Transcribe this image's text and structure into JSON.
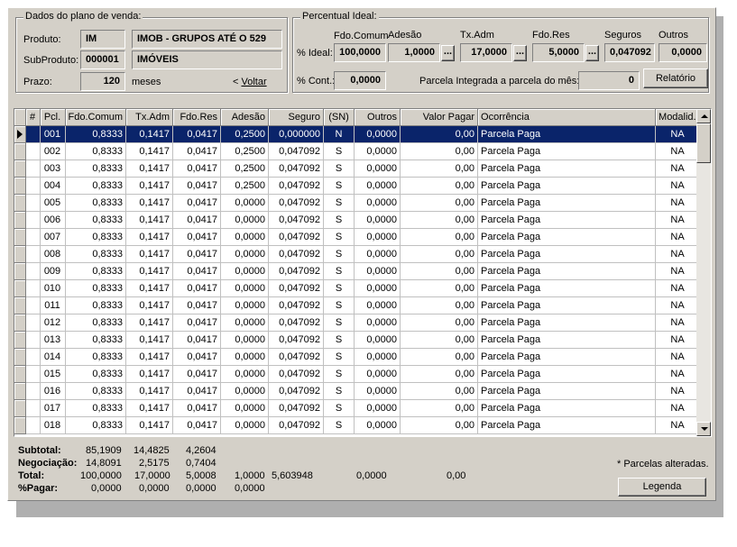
{
  "plano": {
    "group_title": "Dados do plano de venda:",
    "produto_label": "Produto:",
    "produto_code": "IM",
    "produto_desc": "IMOB - GRUPOS ATÉ O 529",
    "subproduto_label": "SubProduto:",
    "subproduto_code": "000001",
    "subproduto_desc": "IMÓVEIS",
    "prazo_label": "Prazo:",
    "prazo_value": "120",
    "prazo_unit": "meses",
    "voltar_prefix": "< ",
    "voltar_label": "Voltar"
  },
  "percentual": {
    "group_title": "Percentual Ideal:",
    "col_fdo_comum": "Fdo.Comum",
    "col_adesao": "Adesão",
    "col_tx_adm": "Tx.Adm",
    "col_fdo_res": "Fdo.Res",
    "col_seguros": "Seguros",
    "col_outros": "Outros",
    "ideal_label": "% Ideal:",
    "ideal_fdo_comum": "100,0000",
    "ideal_adesao": "1,0000",
    "ideal_tx_adm": "17,0000",
    "ideal_fdo_res": "5,0000",
    "ideal_seguros": "0,047092",
    "ideal_outros": "0,0000",
    "dots": "...",
    "cont_label": "% Cont.:",
    "cont_value": "0,0000",
    "parcela_label": "Parcela Integrada a parcela do mês:",
    "parcela_value": "0",
    "relatorio_label": "Relatório"
  },
  "grid": {
    "columns": [
      "#",
      "Pcl.",
      "Fdo.Comum",
      "Tx.Adm",
      "Fdo.Res",
      "Adesão",
      "Seguro",
      "(SN)",
      "Outros",
      "Valor Pagar",
      "Ocorrência",
      "Modalid."
    ],
    "rows": [
      [
        "",
        "001",
        "0,8333",
        "0,1417",
        "0,0417",
        "0,2500",
        "0,000000",
        "N",
        "0,0000",
        "0,00",
        "Parcela Paga",
        "NA"
      ],
      [
        "",
        "002",
        "0,8333",
        "0,1417",
        "0,0417",
        "0,2500",
        "0,047092",
        "S",
        "0,0000",
        "0,00",
        "Parcela Paga",
        "NA"
      ],
      [
        "",
        "003",
        "0,8333",
        "0,1417",
        "0,0417",
        "0,2500",
        "0,047092",
        "S",
        "0,0000",
        "0,00",
        "Parcela Paga",
        "NA"
      ],
      [
        "",
        "004",
        "0,8333",
        "0,1417",
        "0,0417",
        "0,2500",
        "0,047092",
        "S",
        "0,0000",
        "0,00",
        "Parcela Paga",
        "NA"
      ],
      [
        "",
        "005",
        "0,8333",
        "0,1417",
        "0,0417",
        "0,0000",
        "0,047092",
        "S",
        "0,0000",
        "0,00",
        "Parcela Paga",
        "NA"
      ],
      [
        "",
        "006",
        "0,8333",
        "0,1417",
        "0,0417",
        "0,0000",
        "0,047092",
        "S",
        "0,0000",
        "0,00",
        "Parcela Paga",
        "NA"
      ],
      [
        "",
        "007",
        "0,8333",
        "0,1417",
        "0,0417",
        "0,0000",
        "0,047092",
        "S",
        "0,0000",
        "0,00",
        "Parcela Paga",
        "NA"
      ],
      [
        "",
        "008",
        "0,8333",
        "0,1417",
        "0,0417",
        "0,0000",
        "0,047092",
        "S",
        "0,0000",
        "0,00",
        "Parcela Paga",
        "NA"
      ],
      [
        "",
        "009",
        "0,8333",
        "0,1417",
        "0,0417",
        "0,0000",
        "0,047092",
        "S",
        "0,0000",
        "0,00",
        "Parcela Paga",
        "NA"
      ],
      [
        "",
        "010",
        "0,8333",
        "0,1417",
        "0,0417",
        "0,0000",
        "0,047092",
        "S",
        "0,0000",
        "0,00",
        "Parcela Paga",
        "NA"
      ],
      [
        "",
        "011",
        "0,8333",
        "0,1417",
        "0,0417",
        "0,0000",
        "0,047092",
        "S",
        "0,0000",
        "0,00",
        "Parcela Paga",
        "NA"
      ],
      [
        "",
        "012",
        "0,8333",
        "0,1417",
        "0,0417",
        "0,0000",
        "0,047092",
        "S",
        "0,0000",
        "0,00",
        "Parcela Paga",
        "NA"
      ],
      [
        "",
        "013",
        "0,8333",
        "0,1417",
        "0,0417",
        "0,0000",
        "0,047092",
        "S",
        "0,0000",
        "0,00",
        "Parcela Paga",
        "NA"
      ],
      [
        "",
        "014",
        "0,8333",
        "0,1417",
        "0,0417",
        "0,0000",
        "0,047092",
        "S",
        "0,0000",
        "0,00",
        "Parcela Paga",
        "NA"
      ],
      [
        "",
        "015",
        "0,8333",
        "0,1417",
        "0,0417",
        "0,0000",
        "0,047092",
        "S",
        "0,0000",
        "0,00",
        "Parcela Paga",
        "NA"
      ],
      [
        "",
        "016",
        "0,8333",
        "0,1417",
        "0,0417",
        "0,0000",
        "0,047092",
        "S",
        "0,0000",
        "0,00",
        "Parcela Paga",
        "NA"
      ],
      [
        "",
        "017",
        "0,8333",
        "0,1417",
        "0,0417",
        "0,0000",
        "0,047092",
        "S",
        "0,0000",
        "0,00",
        "Parcela Paga",
        "NA"
      ],
      [
        "",
        "018",
        "0,8333",
        "0,1417",
        "0,0417",
        "0,0000",
        "0,047092",
        "S",
        "0,0000",
        "0,00",
        "Parcela Paga",
        "NA"
      ]
    ],
    "selected_row": 0
  },
  "totals": {
    "subtotal_label": "Subtotal:",
    "subtotal_values": [
      "85,1909",
      "14,4825",
      "4,2604"
    ],
    "negociacao_label": "Negociação:",
    "negociacao_values": [
      "14,8091",
      "2,5175",
      "0,7404"
    ],
    "total_label": "Total:",
    "total_values": [
      "100,0000",
      "17,0000",
      "5,0008",
      "1,0000",
      "5,603948",
      "0,0000",
      "0,00"
    ],
    "pagar_label": "%Pagar:",
    "pagar_values": [
      "0,0000",
      "0,0000",
      "0,0000",
      "0,0000"
    ],
    "parcelas_note": "* Parcelas alteradas.",
    "legenda_label": "Legenda"
  },
  "colors": {
    "window_bg": "#d4d0c8",
    "selection_bg": "#0a246a",
    "selection_fg": "#ffffff"
  }
}
